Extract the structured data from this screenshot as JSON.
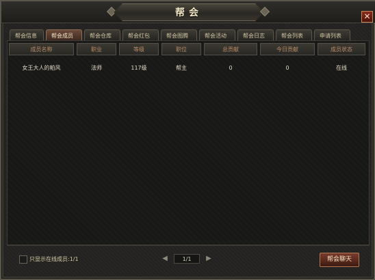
{
  "window": {
    "title": "帮会",
    "close_label": "✕"
  },
  "tabs": [
    {
      "label": "帮会信息"
    },
    {
      "label": "帮会成员",
      "active": true
    },
    {
      "label": "帮会仓库"
    },
    {
      "label": "帮会红包"
    },
    {
      "label": "帮会图腾"
    },
    {
      "label": "帮会活动"
    },
    {
      "label": "帮会日志"
    },
    {
      "label": "帮会列表"
    },
    {
      "label": "申请列表"
    }
  ],
  "members_table": {
    "columns": [
      "成员名称",
      "职业",
      "等级",
      "职位",
      "总贡献",
      "今日贡献",
      "成员状态"
    ],
    "rows": [
      [
        "女王大人的帕风",
        "法师",
        "117级",
        "帮主",
        "0",
        "0",
        "在线"
      ]
    ]
  },
  "footer": {
    "online_only_label": "只显示在线成员",
    "online_count": ":1/1",
    "page": "1/1",
    "prev_icon": "◀",
    "next_icon": "▶",
    "chat_button_label": "帮会聊天"
  }
}
